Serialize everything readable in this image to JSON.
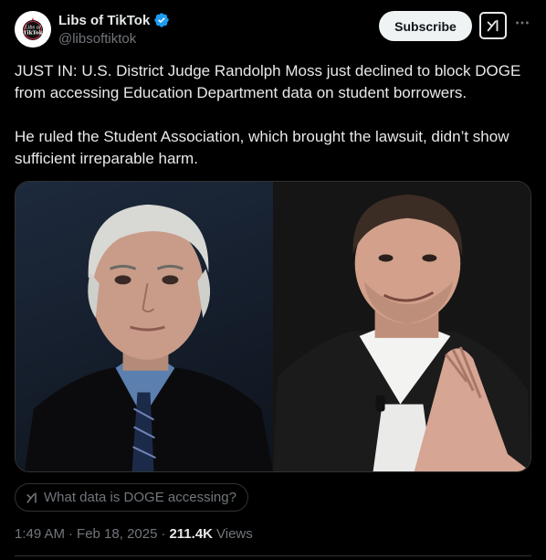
{
  "author": {
    "display_name": "Libs of TikTok",
    "handle": "@libsoftiktok",
    "avatar_text": "Libs of TikTok",
    "verified_icon": "verified-badge-icon"
  },
  "actions": {
    "subscribe_label": "Subscribe",
    "grok_icon": "grok-icon",
    "more_icon": "more-dots-icon"
  },
  "tweet": {
    "paragraphs": [
      "JUST IN: U.S. District Judge Randolph Moss just declined to block DOGE from accessing Education Department data on student borrowers.",
      "He ruled the Student Association, which brought the lawsuit, didn’t show sufficient irreparable harm."
    ]
  },
  "media": {
    "photos": [
      "photo-judge",
      "photo-elon"
    ]
  },
  "grok_prompt": {
    "label": "What data is DOGE accessing?"
  },
  "meta": {
    "time": "1:49 AM",
    "separator": "·",
    "date": "Feb 18, 2025",
    "views_count": "211.4K",
    "views_label": "Views"
  },
  "colors": {
    "background": "#000000",
    "text": "#e7e9ea",
    "muted": "#71767b",
    "border": "#2f3336",
    "verified": "#1d9bf0",
    "button_bg": "#eff3f4"
  }
}
